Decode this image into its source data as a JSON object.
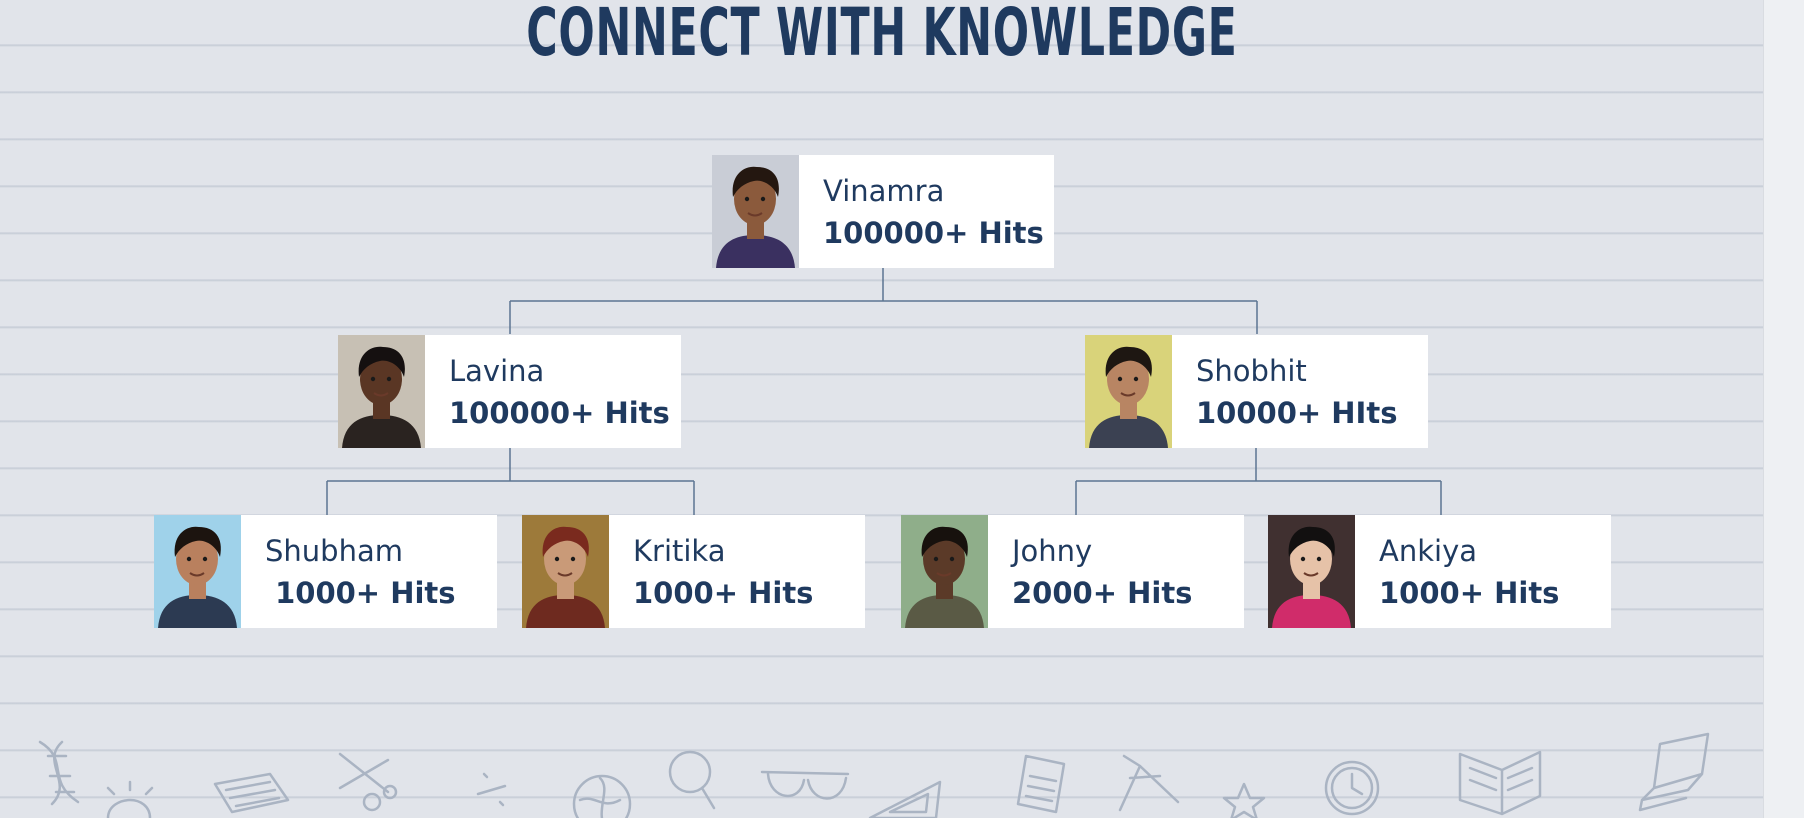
{
  "title": "CONNECT WITH KNOWLEDGE",
  "people": {
    "vinamra": {
      "name": "Vinamra",
      "hits": "100000+ Hits",
      "skin": "#8b5a3c",
      "hair": "#241710",
      "shirt": "#3a3060",
      "bg": "#c9cdd6"
    },
    "lavina": {
      "name": "Lavina",
      "hits": "100000+ Hits",
      "skin": "#5a3624",
      "hair": "#151010",
      "shirt": "#2a2320",
      "bg": "#c7c0b4"
    },
    "shobhit": {
      "name": "Shobhit",
      "hits": "10000+ HIts",
      "skin": "#b88563",
      "hair": "#1e1712",
      "shirt": "#3b4152",
      "bg": "#d9d37a"
    },
    "shubham": {
      "name": "Shubham",
      "hits": " 1000+ Hits",
      "skin": "#b9805e",
      "hair": "#1c140f",
      "shirt": "#2c3a52",
      "bg": "#9fd2ea"
    },
    "kritika": {
      "name": "Kritika",
      "hits": "1000+ Hits",
      "skin": "#c99a78",
      "hair": "#7a2a1e",
      "shirt": "#6e2a1f",
      "bg": "#9d7a3a"
    },
    "johny": {
      "name": "Johny",
      "hits": "2000+ Hits",
      "skin": "#5b3a28",
      "hair": "#17110d",
      "shirt": "#5a5a45",
      "bg": "#8fae8a"
    },
    "ankiya": {
      "name": "Ankiya",
      "hits": "1000+ Hits",
      "skin": "#e6c2a8",
      "hair": "#121010",
      "shirt": "#d02c6a",
      "bg": "#403030"
    }
  },
  "colors": {
    "accent": "#1f3a5f",
    "connector": "#5c7591",
    "paper": "#e1e4ea",
    "card": "#ffffff"
  },
  "doodle_icons": [
    "dna-icon",
    "lightbulb-icon",
    "newspaper-icon",
    "scissors-icon",
    "percent-icon",
    "globe-icon",
    "magnifier-icon",
    "glasses-icon",
    "set-square-icon",
    "document-icon",
    "compass-icon",
    "star-icon",
    "clock-icon",
    "open-book-icon",
    "closed-book-icon"
  ]
}
